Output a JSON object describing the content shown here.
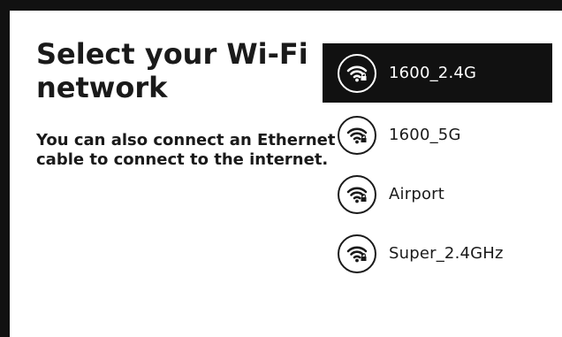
{
  "header": {
    "title": "Select your Wi-Fi network",
    "subtitle": "You can also connect an Ethernet cable to connect to the internet."
  },
  "networks": [
    {
      "ssid": "1600_2.4G",
      "icon": "wifi-lock-icon",
      "selected": true
    },
    {
      "ssid": "1600_5G",
      "icon": "wifi-lock-icon",
      "selected": false
    },
    {
      "ssid": "Airport",
      "icon": "wifi-lock-icon",
      "selected": false
    },
    {
      "ssid": "Super_2.4GHz",
      "icon": "wifi-lock-icon",
      "selected": false
    }
  ],
  "colors": {
    "frame": "#111111",
    "background": "#ffffff",
    "selected_bg": "#111111",
    "selected_fg": "#ffffff",
    "text": "#1a1a1a"
  }
}
